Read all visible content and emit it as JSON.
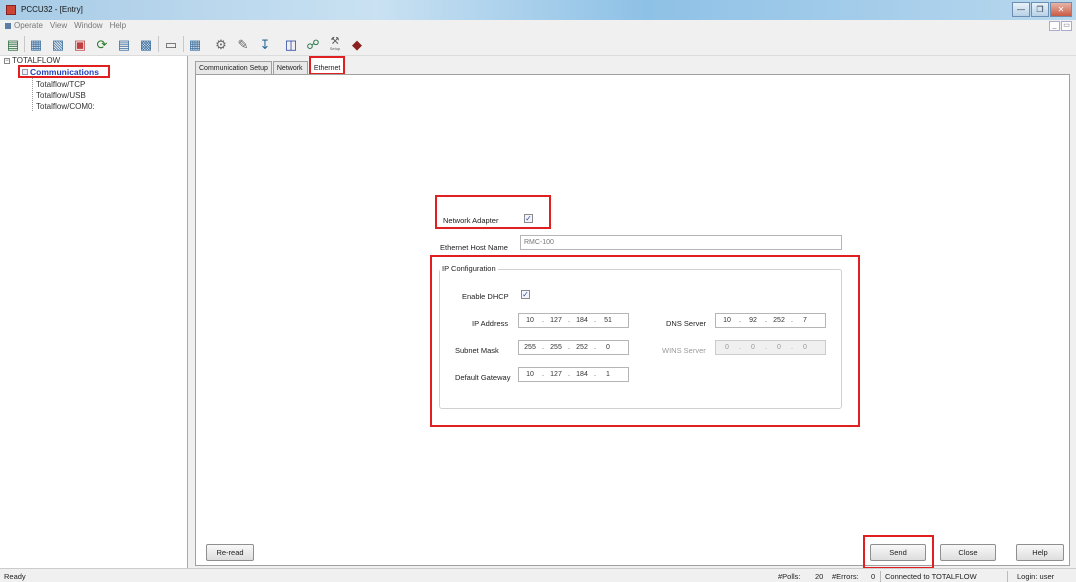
{
  "window": {
    "title": "PCCU32 - [Entry]"
  },
  "menu": {
    "items": [
      "Operate",
      "View",
      "Window",
      "Help"
    ]
  },
  "toolbar": {
    "icons": [
      "entry-icon",
      "collect-icon",
      "calc-icon",
      "chart-icon",
      "refresh-icon",
      "trend-icon",
      "report-icon",
      "monitor-icon",
      "display-icon",
      "tools-icon",
      "config-icon",
      "download-icon",
      "io-icon",
      "network-icon",
      "setup-icon",
      "help-book-icon"
    ],
    "setup_label": "Setup"
  },
  "tree": {
    "root": "TOTALFLOW",
    "selected": "Communications",
    "children": [
      "Totalflow/TCP",
      "Totalflow/USB",
      "Totalflow/COM0:"
    ]
  },
  "tabs": [
    {
      "label": "Communication Setup"
    },
    {
      "label": "Network"
    },
    {
      "label": "Ethernet"
    }
  ],
  "form": {
    "network_adapter_label": "Network Adapter",
    "network_adapter_checked": true,
    "host_name_label": "Ethernet Host Name",
    "host_name_value": "RMC-100",
    "ip_config_title": "IP Configuration",
    "enable_dhcp_label": "Enable DHCP",
    "enable_dhcp_checked": true,
    "ip_address_label": "IP Address",
    "ip_address": [
      "10",
      "127",
      "184",
      "51"
    ],
    "subnet_mask_label": "Subnet Mask",
    "subnet_mask": [
      "255",
      "255",
      "252",
      "0"
    ],
    "default_gateway_label": "Default Gateway",
    "default_gateway": [
      "10",
      "127",
      "184",
      "1"
    ],
    "dns_server_label": "DNS Server",
    "dns_server": [
      "10",
      "92",
      "252",
      "7"
    ],
    "wins_server_label": "WINS Server",
    "wins_server": [
      "0",
      "0",
      "0",
      "0"
    ]
  },
  "buttons": {
    "reread": "Re-read",
    "send": "Send",
    "close": "Close",
    "help": "Help"
  },
  "status": {
    "ready": "Ready",
    "polls_label": "#Polls:",
    "polls_value": "20",
    "errors_label": "#Errors:",
    "errors_value": "0",
    "connection": "Connected to TOTALFLOW",
    "login": "Login: user"
  },
  "colors": {
    "highlight": "#e02020",
    "tree_selected_text": "#2142b9",
    "check_mark": "#2b4fa8"
  }
}
